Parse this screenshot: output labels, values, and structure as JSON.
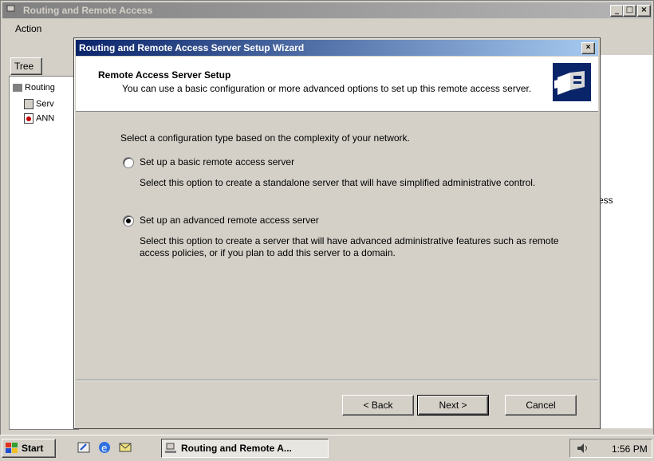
{
  "main_window": {
    "title": "Routing and Remote Access",
    "menu": {
      "action": "Action"
    },
    "tree_tab": "Tree",
    "tree_items": [
      "Routing",
      "Serv",
      "ANN"
    ],
    "right_panel_text": "ess"
  },
  "wizard": {
    "title": "Routing and Remote Access Server Setup Wizard",
    "header": {
      "title": "Remote Access Server Setup",
      "subtitle": "You can use a basic configuration or more advanced options to set up this remote access server."
    },
    "intro": "Select a configuration type based on the complexity of your network.",
    "options": [
      {
        "label": "Set up a basic remote access server",
        "description": "Select this option to create a standalone server that will have simplified administrative control.",
        "selected": false
      },
      {
        "label": "Set up an advanced remote access server",
        "description": "Select this option to create a server that will have advanced administrative features such as remote access policies, or if you plan to add this server to a domain.",
        "selected": true
      }
    ],
    "buttons": {
      "back": "< Back",
      "next": "Next >",
      "cancel": "Cancel"
    },
    "close": "×"
  },
  "taskbar": {
    "start": "Start",
    "task": "Routing and Remote A...",
    "clock": "1:56 PM"
  },
  "colors": {
    "title_active": "#0a246a",
    "title_inactive": "#808080",
    "face": "#d4d0c8"
  }
}
